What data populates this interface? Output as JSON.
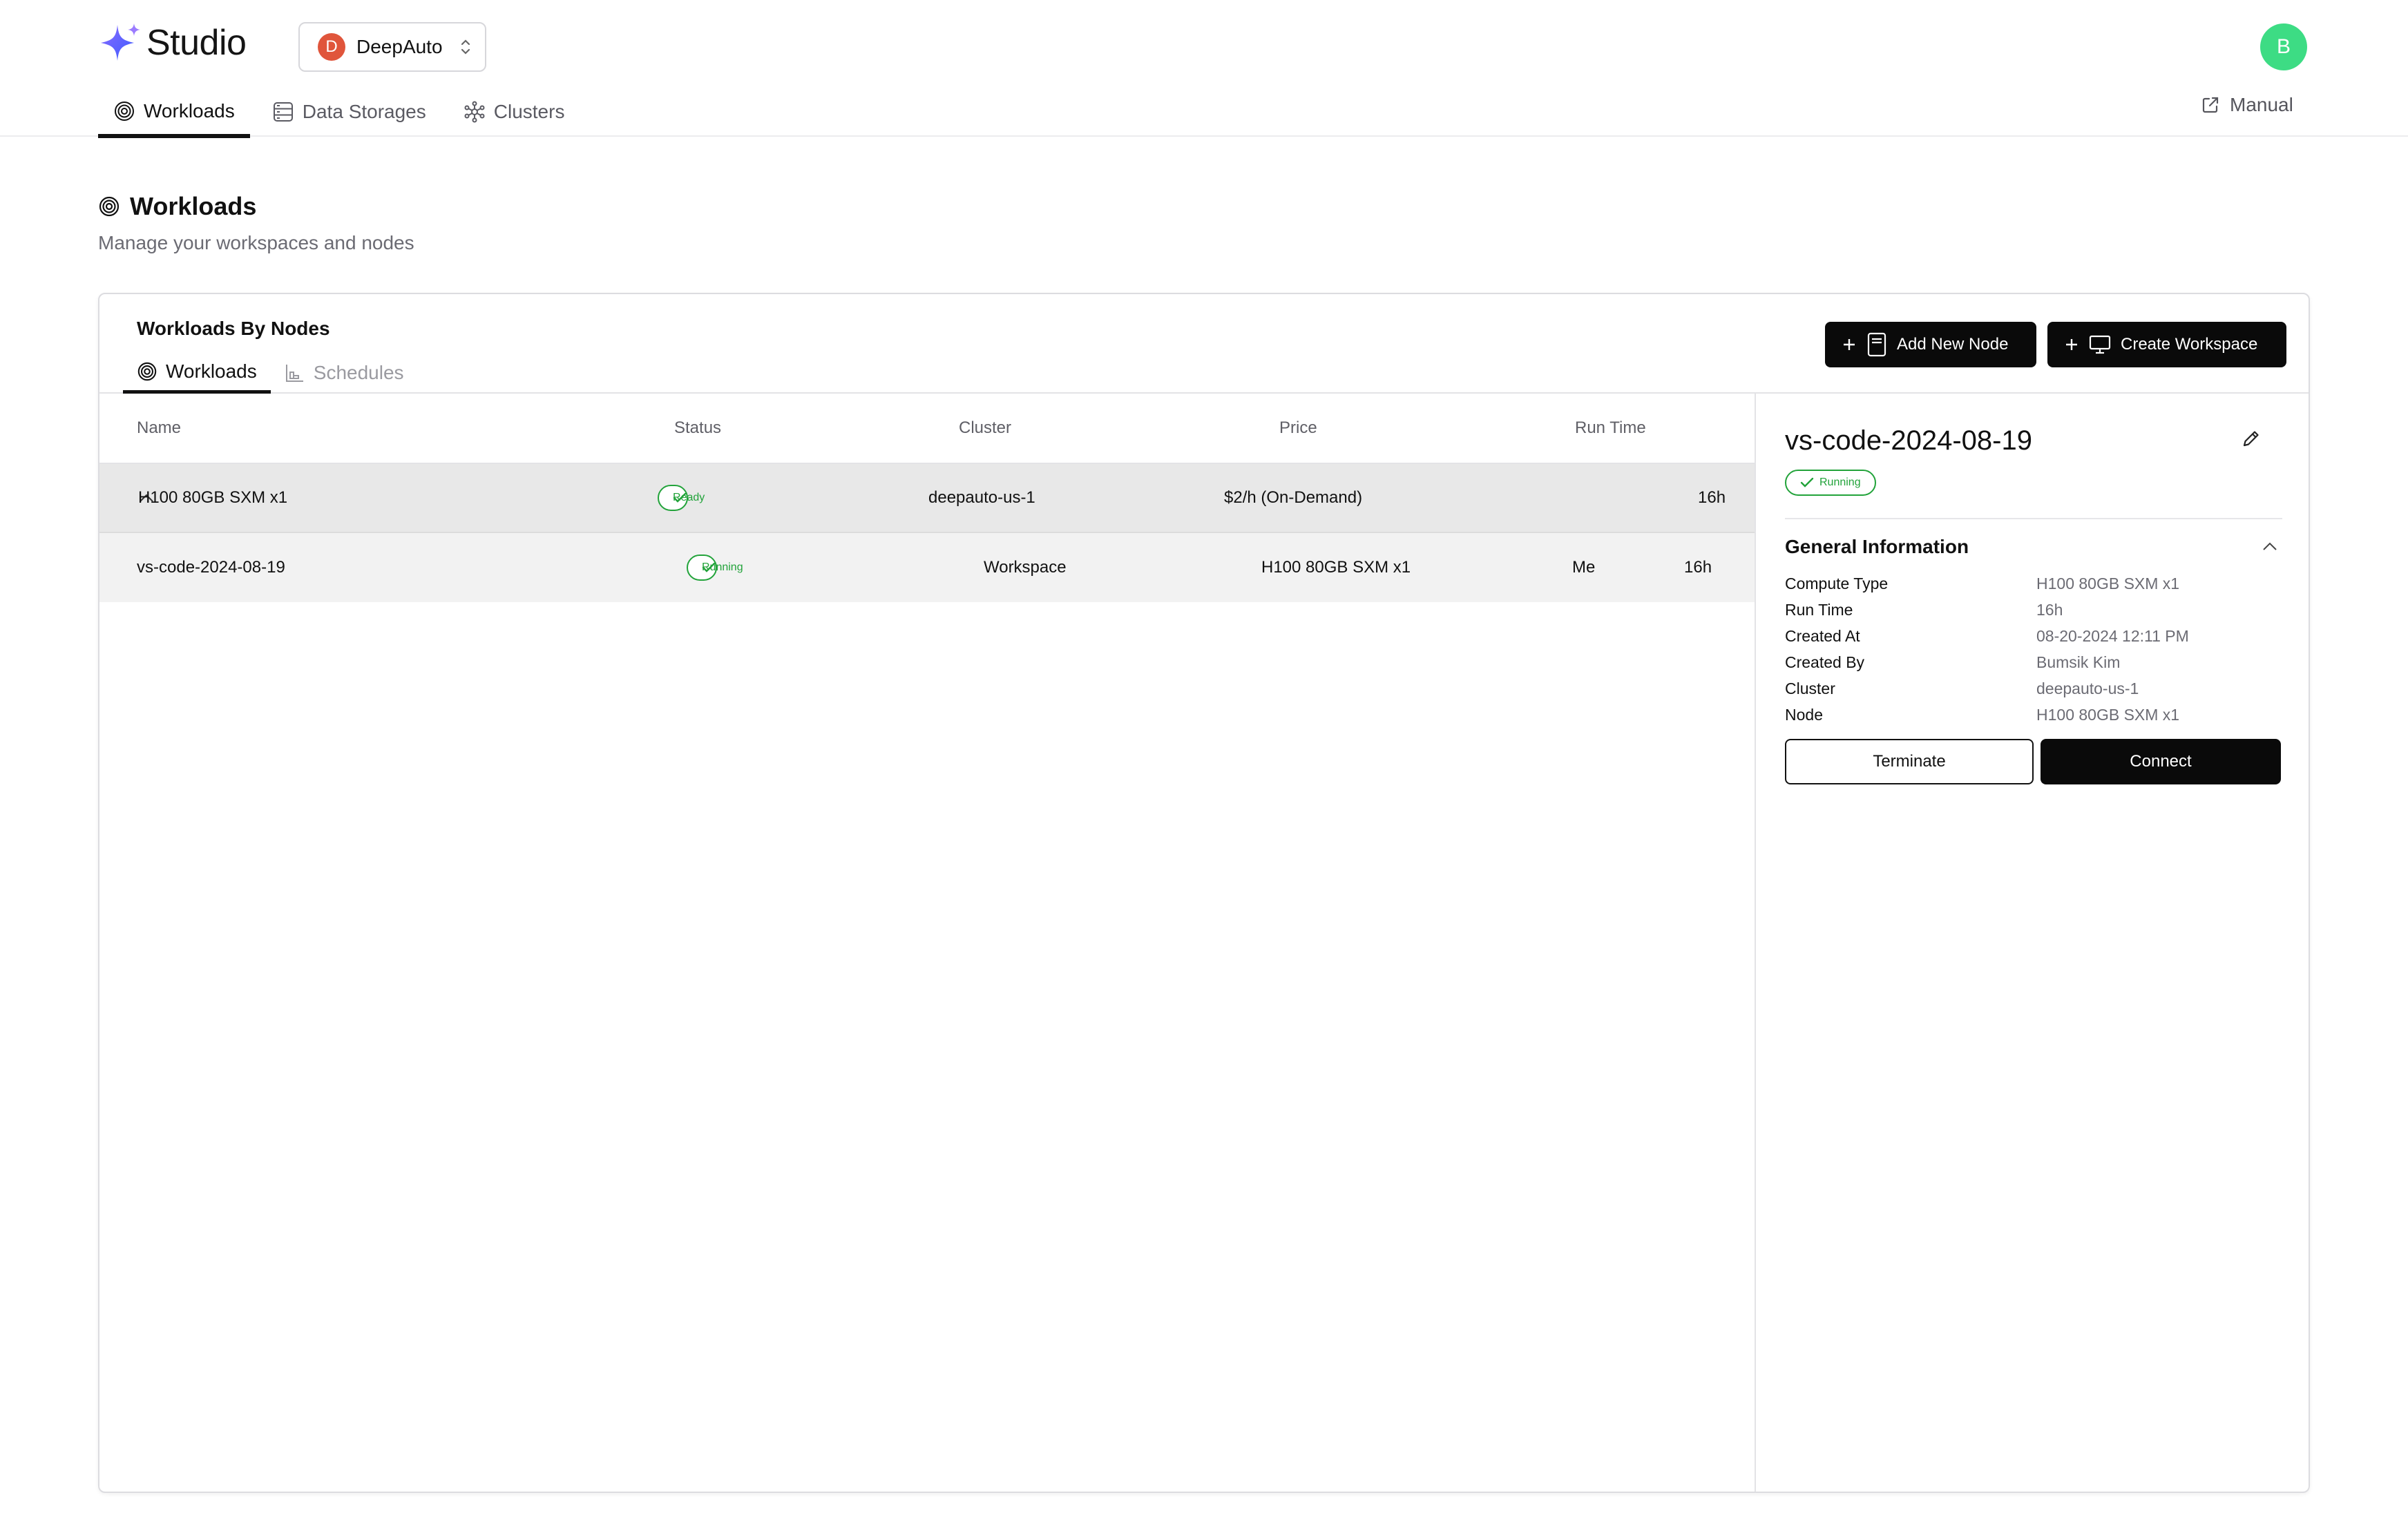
{
  "app": {
    "name": "Studio"
  },
  "org": {
    "initial": "D",
    "name": "DeepAuto"
  },
  "user": {
    "initial": "B"
  },
  "nav": {
    "tabs": [
      {
        "label": "Workloads",
        "icon": "workloads-icon",
        "active": true
      },
      {
        "label": "Data Storages",
        "icon": "database-icon",
        "active": false
      },
      {
        "label": "Clusters",
        "icon": "clusters-icon",
        "active": false
      }
    ],
    "manual_label": "Manual"
  },
  "page": {
    "title": "Workloads",
    "subtitle": "Manage your workspaces and nodes"
  },
  "card": {
    "title": "Workloads By Nodes",
    "tabs": [
      {
        "label": "Workloads",
        "active": true
      },
      {
        "label": "Schedules",
        "active": false
      }
    ],
    "add_node_label": "Add New Node",
    "create_workspace_label": "Create Workspace"
  },
  "table": {
    "columns": [
      "Name",
      "Status",
      "Cluster",
      "Price",
      "Run Time"
    ],
    "node_row": {
      "name": "H100 80GB SXM x1",
      "status": "Ready",
      "cluster": "deepauto-us-1",
      "price": "$2/h (On-Demand)",
      "run_time": "16h"
    },
    "workspace_row": {
      "name": "vs-code-2024-08-19",
      "status": "Running",
      "type": "Workspace",
      "node": "H100 80GB SXM x1",
      "owner": "Me",
      "run_time": "16h"
    }
  },
  "detail": {
    "title": "vs-code-2024-08-19",
    "status": "Running",
    "section_title": "General Information",
    "info": [
      {
        "label": "Compute Type",
        "value": "H100 80GB SXM x1"
      },
      {
        "label": "Run Time",
        "value": "16h"
      },
      {
        "label": "Created At",
        "value": "08-20-2024 12:11 PM"
      },
      {
        "label": "Created By",
        "value": "Bumsik Kim"
      },
      {
        "label": "Cluster",
        "value": "deepauto-us-1"
      },
      {
        "label": "Node",
        "value": "H100 80GB SXM x1"
      }
    ],
    "terminate_label": "Terminate",
    "connect_label": "Connect"
  },
  "colors": {
    "accent_black": "#0a0a0a",
    "status_green": "#22a33a",
    "org_avatar": "#e0553b",
    "user_avatar": "#3ddc84",
    "node_row_bg": "#e8e8e8"
  }
}
